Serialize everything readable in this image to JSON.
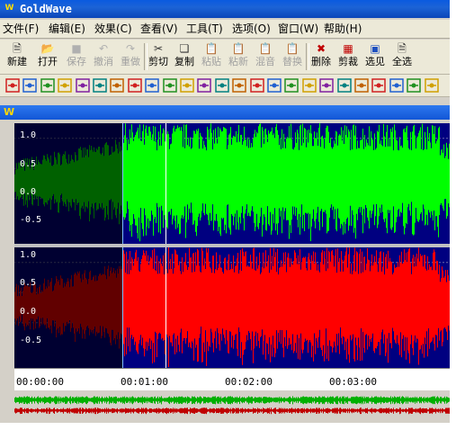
{
  "app": {
    "title": "GoldWave",
    "icon": "goldwave-icon",
    "accent": "#0a5ae0"
  },
  "menu": [
    "文件(F)",
    "编辑(E)",
    "效果(C)",
    "查看(V)",
    "工具(T)",
    "选项(O)",
    "窗口(W)",
    "帮助(H)"
  ],
  "toolbar": {
    "buttons": [
      {
        "label": "新建",
        "icon": "new-file-icon",
        "enabled": true
      },
      {
        "label": "打开",
        "icon": "open-folder-icon",
        "enabled": true
      },
      {
        "label": "保存",
        "icon": "save-disk-icon",
        "enabled": false
      },
      {
        "label": "撤消",
        "icon": "undo-icon",
        "enabled": false
      },
      {
        "label": "重做",
        "icon": "redo-icon",
        "enabled": false
      },
      {
        "label": "剪切",
        "icon": "scissors-icon",
        "enabled": true
      },
      {
        "label": "复制",
        "icon": "copy-icon",
        "enabled": true
      },
      {
        "label": "粘贴",
        "icon": "paste-icon",
        "enabled": false
      },
      {
        "label": "粘新",
        "icon": "paste-new-icon",
        "enabled": false
      },
      {
        "label": "混音",
        "icon": "mix-icon",
        "enabled": false
      },
      {
        "label": "替换",
        "icon": "replace-icon",
        "enabled": false
      },
      {
        "label": "删除",
        "icon": "delete-icon",
        "enabled": true
      },
      {
        "label": "剪裁",
        "icon": "trim-icon",
        "enabled": true
      },
      {
        "label": "选见",
        "icon": "select-view-icon",
        "enabled": true
      },
      {
        "label": "全选",
        "icon": "select-all-icon",
        "enabled": true
      }
    ]
  },
  "effects_toolbar": {
    "icons": [
      "doppler-icon",
      "dynamics-icon",
      "echo-icon",
      "equalizer-icon",
      "fade-icon",
      "filter-icon",
      "flanger-icon",
      "interpolate-icon",
      "invert-icon",
      "matrix-icon",
      "mechanize-icon",
      "offset-icon",
      "pan-icon",
      "pitch-icon",
      "playback-rate-icon",
      "resample-icon",
      "reverb-icon",
      "reverse-icon",
      "silence-icon",
      "stereo-icon",
      "time-warp-icon",
      "volume-icon",
      "noise-reduction-icon",
      "spectrum-icon",
      "tc-icon"
    ]
  },
  "document": {
    "icon": "document-icon"
  },
  "channels": [
    {
      "name": "left",
      "color": "#00ff00",
      "background": "#000080",
      "y_ticks": [
        "1.0",
        "0.5",
        "0.0",
        "-0.5"
      ]
    },
    {
      "name": "right",
      "color": "#ff0000",
      "background": "#000080",
      "y_ticks": [
        "1.0",
        "0.5",
        "0.0",
        "-0.5"
      ]
    }
  ],
  "selection": {
    "start_fraction": 0.25,
    "cursor_fraction": 0.35,
    "unselected_shade": "#000000"
  },
  "timeline": {
    "labels": [
      "00:00:00",
      "00:01:00",
      "00:02:00",
      "00:03:00"
    ]
  }
}
